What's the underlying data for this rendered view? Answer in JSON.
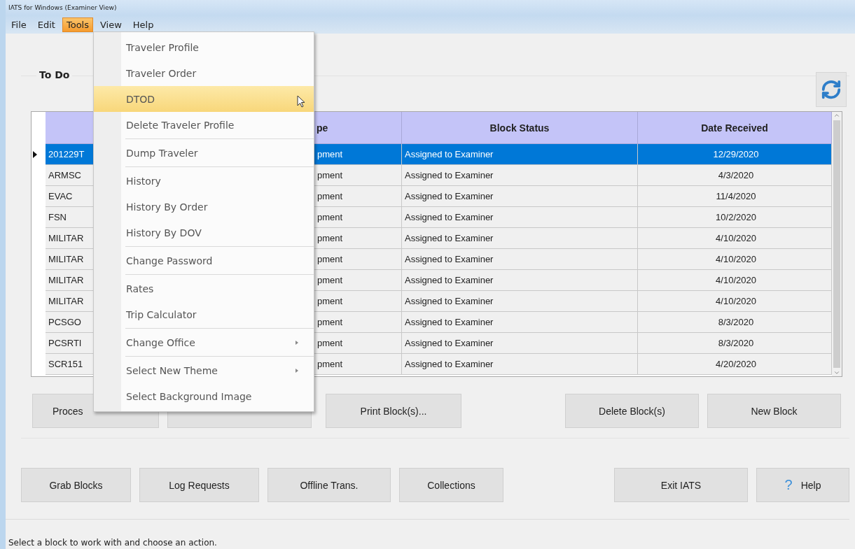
{
  "window": {
    "title": "IATS for Windows (Examiner View)"
  },
  "menubar": [
    {
      "label": "File",
      "selected": false
    },
    {
      "label": "Edit",
      "selected": false
    },
    {
      "label": "Tools",
      "selected": true
    },
    {
      "label": "View",
      "selected": false
    },
    {
      "label": "Help",
      "selected": false
    }
  ],
  "tools_menu": {
    "groups": [
      [
        {
          "label": "Traveler Profile",
          "highlighted": false,
          "submenu": false
        },
        {
          "label": "Traveler Order",
          "highlighted": false,
          "submenu": false
        },
        {
          "label": "DTOD",
          "highlighted": true,
          "submenu": false
        },
        {
          "label": "Delete Traveler Profile",
          "highlighted": false,
          "submenu": false
        }
      ],
      [
        {
          "label": "Dump Traveler",
          "highlighted": false,
          "submenu": false
        }
      ],
      [
        {
          "label": "History",
          "highlighted": false,
          "submenu": false
        },
        {
          "label": "History By Order",
          "highlighted": false,
          "submenu": false
        },
        {
          "label": "History By DOV",
          "highlighted": false,
          "submenu": false
        }
      ],
      [
        {
          "label": "Change Password",
          "highlighted": false,
          "submenu": false
        }
      ],
      [
        {
          "label": "Rates",
          "highlighted": false,
          "submenu": false
        },
        {
          "label": "Trip Calculator",
          "highlighted": false,
          "submenu": false
        }
      ],
      [
        {
          "label": "Change Office",
          "highlighted": false,
          "submenu": true
        }
      ],
      [
        {
          "label": "Select New Theme",
          "highlighted": false,
          "submenu": true
        },
        {
          "label": "Select Background Image",
          "highlighted": false,
          "submenu": false
        }
      ]
    ]
  },
  "todo": {
    "title": "To Do",
    "table": {
      "columns": [
        "",
        "pe",
        "Block Status",
        "Date Received"
      ],
      "rows": [
        {
          "column_1": "201229T",
          "column_2": "pment",
          "status": "Assigned to Examiner",
          "date": "12/29/2020",
          "selected": true
        },
        {
          "column_1": "ARMSC",
          "column_2": "pment",
          "status": "Assigned to Examiner",
          "date": "4/3/2020",
          "selected": false
        },
        {
          "column_1": "EVAC",
          "column_2": "pment",
          "status": "Assigned to Examiner",
          "date": "11/4/2020",
          "selected": false
        },
        {
          "column_1": "FSN",
          "column_2": "pment",
          "status": "Assigned to Examiner",
          "date": "10/2/2020",
          "selected": false
        },
        {
          "column_1": "MILITAR",
          "column_2": "pment",
          "status": "Assigned to Examiner",
          "date": "4/10/2020",
          "selected": false
        },
        {
          "column_1": "MILITAR",
          "column_2": "pment",
          "status": "Assigned to Examiner",
          "date": "4/10/2020",
          "selected": false
        },
        {
          "column_1": "MILITAR",
          "column_2": "pment",
          "status": "Assigned to Examiner",
          "date": "4/10/2020",
          "selected": false
        },
        {
          "column_1": "MILITAR",
          "column_2": "pment",
          "status": "Assigned to Examiner",
          "date": "4/10/2020",
          "selected": false
        },
        {
          "column_1": "PCSGO",
          "column_2": "pment",
          "status": "Assigned to Examiner",
          "date": "8/3/2020",
          "selected": false
        },
        {
          "column_1": "PCSRTI",
          "column_2": "pment",
          "status": "Assigned to Examiner",
          "date": "8/3/2020",
          "selected": false
        },
        {
          "column_1": "SCR151",
          "column_2": "pment",
          "status": "Assigned to Examiner",
          "date": "4/20/2020",
          "selected": false
        }
      ]
    },
    "block_buttons_left": [
      "Proces",
      "Print Block(s)..."
    ],
    "block_buttons_right": [
      "Delete Block(s)",
      "New Block"
    ]
  },
  "bottom_buttons_left": [
    "Grab Blocks",
    "Log Requests",
    "Offline Trans.",
    "Collections"
  ],
  "bottom_buttons_right": [
    {
      "label": "Exit IATS"
    },
    {
      "label": "Help",
      "icon": "?"
    }
  ],
  "status_bar": "Select a block to work with and choose an action."
}
